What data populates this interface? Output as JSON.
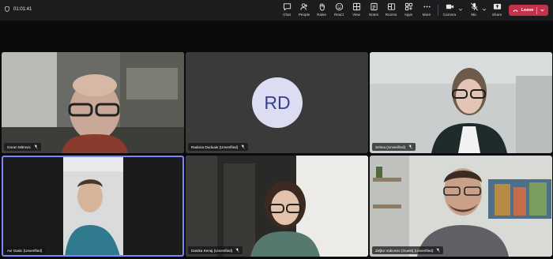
{
  "meeting": {
    "elapsed": "01:01:41"
  },
  "toolbar": {
    "chat": "Chat",
    "people": "People",
    "raise": "Raise",
    "react": "React",
    "view": "View",
    "notes": "Notes",
    "rooms": "Rooms",
    "apps": "Apps",
    "more": "More",
    "camera": "Camera",
    "mic": "Mic",
    "share": "Share",
    "leave": "Leave"
  },
  "participants": [
    {
      "name": "Goran Mitrovic",
      "video": true
    },
    {
      "name": "Radona Duduais (Unverified)",
      "video": false,
      "initials": "RD"
    },
    {
      "name": "Selma (Unverified)",
      "video": true
    },
    {
      "name": "Avi Gasic (Unverified)",
      "video": true,
      "active": true
    },
    {
      "name": "Danika Kenaj (Unverified)",
      "video": true
    },
    {
      "name": "Zeljko Vukcevic (Guest) (Unverified)",
      "video": true
    }
  ],
  "colors": {
    "leave": "#c4314b",
    "active_outline": "#7f85f5",
    "avatar_bg": "#dcdcf2",
    "avatar_text": "#3b3f8a"
  }
}
